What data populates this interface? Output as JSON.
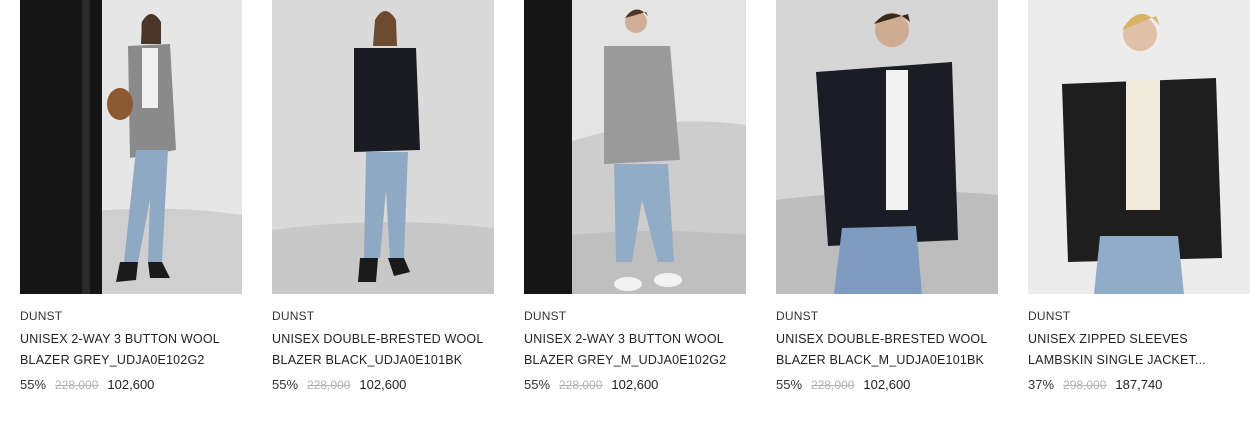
{
  "products": [
    {
      "brand": "DUNST",
      "name_line1": "UNISEX 2-WAY 3 BUTTON WOOL",
      "name_line2": "BLAZER GREY_UDJA0E102G2",
      "discount": "55%",
      "original_price": "228,000",
      "sale_price": "102,600",
      "colors": {
        "top": "#8a8a8a",
        "jeans": "#8fa8c4"
      }
    },
    {
      "brand": "DUNST",
      "name_line1": "UNISEX DOUBLE-BRESTED WOOL",
      "name_line2": "BLAZER BLACK_UDJA0E101BK",
      "discount": "55%",
      "original_price": "228,000",
      "sale_price": "102,600",
      "colors": {
        "top": "#1b1c22",
        "jeans": "#8fa8c4"
      }
    },
    {
      "brand": "DUNST",
      "name_line1": "UNISEX 2-WAY 3 BUTTON WOOL",
      "name_line2": "BLAZER GREY_M_UDJA0E102G2",
      "discount": "55%",
      "original_price": "228,000",
      "sale_price": "102,600",
      "colors": {
        "top": "#9a9a9a",
        "jeans": "#93acc6"
      }
    },
    {
      "brand": "DUNST",
      "name_line1": "UNISEX DOUBLE-BRESTED WOOL",
      "name_line2": "BLAZER BLACK_M_UDJA0E101BK",
      "discount": "55%",
      "original_price": "228,000",
      "sale_price": "102,600",
      "colors": {
        "top": "#1a1c26",
        "jeans": "#7e9cbf"
      }
    },
    {
      "brand": "DUNST",
      "name_line1": "UNISEX ZIPPED SLEEVES",
      "name_line2": "LAMBSKIN SINGLE JACKET...",
      "discount": "37%",
      "original_price": "298,000",
      "sale_price": "187,740",
      "colors": {
        "top": "#1e1e1e",
        "jeans": "#90acc8"
      }
    }
  ]
}
